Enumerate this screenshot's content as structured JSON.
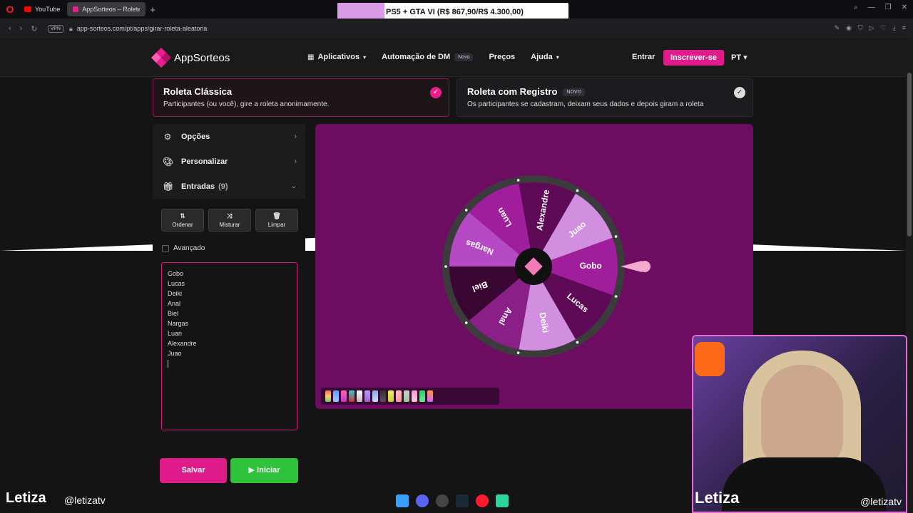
{
  "browser": {
    "tabs": [
      {
        "label": "YouTube",
        "color": "#ff0000"
      },
      {
        "label": "AppSorteos – Roleta Alea",
        "color": "#e91e8c"
      }
    ],
    "new_tab": "+",
    "url": "app-sorteos.com/pt/apps/girar-roleta-aleatoria",
    "vpn": "VPN",
    "banner": "PS5 + GTA VI (R$ 867,90/R$ 4.300,00)"
  },
  "header": {
    "logo": "AppSorteos",
    "menu": {
      "apps": "Aplicativos",
      "dm": "Automação de DM",
      "dm_badge": "Novo",
      "prices": "Preços",
      "help": "Ajuda"
    },
    "login": "Entrar",
    "signup": "Inscrever-se",
    "lang": "PT"
  },
  "modes": [
    {
      "title": "Roleta Clássica",
      "desc": "Participantes (ou você), gire a roleta anonimamente.",
      "selected": true
    },
    {
      "title": "Roleta com Registro",
      "badge": "NOVO",
      "desc": "Os participantes se cadastram, deixam seus dados e depois giram a roleta",
      "selected": false
    }
  ],
  "sidebar": {
    "options": "Opções",
    "customize": "Personalizar",
    "entries": "Entradas",
    "entries_count": "(9)",
    "tools": {
      "sort": "Ordenar",
      "shuffle": "Misturar",
      "clear": "Limpar"
    },
    "advanced": "Avançado",
    "names": [
      "Gobo",
      "Lucas",
      "Deiki",
      "Anal",
      "Biel",
      "Nargas",
      "Luan",
      "Alexandre",
      "Juao"
    ]
  },
  "actions": {
    "save": "Salvar",
    "start": "▶ Iniciar"
  },
  "wheel": {
    "colors": [
      "#a01d9c",
      "#5e0a57",
      "#d28fe0",
      "#8a1f88",
      "#3a0632",
      "#b54ac4"
    ],
    "segments": [
      "Gobo",
      "Lucas",
      "Deiki",
      "Anal",
      "Biel",
      "Nargas",
      "Luan",
      "Alexandre",
      "Juao"
    ]
  },
  "stream": {
    "name": "Letiza",
    "handle": "@letizatv"
  }
}
